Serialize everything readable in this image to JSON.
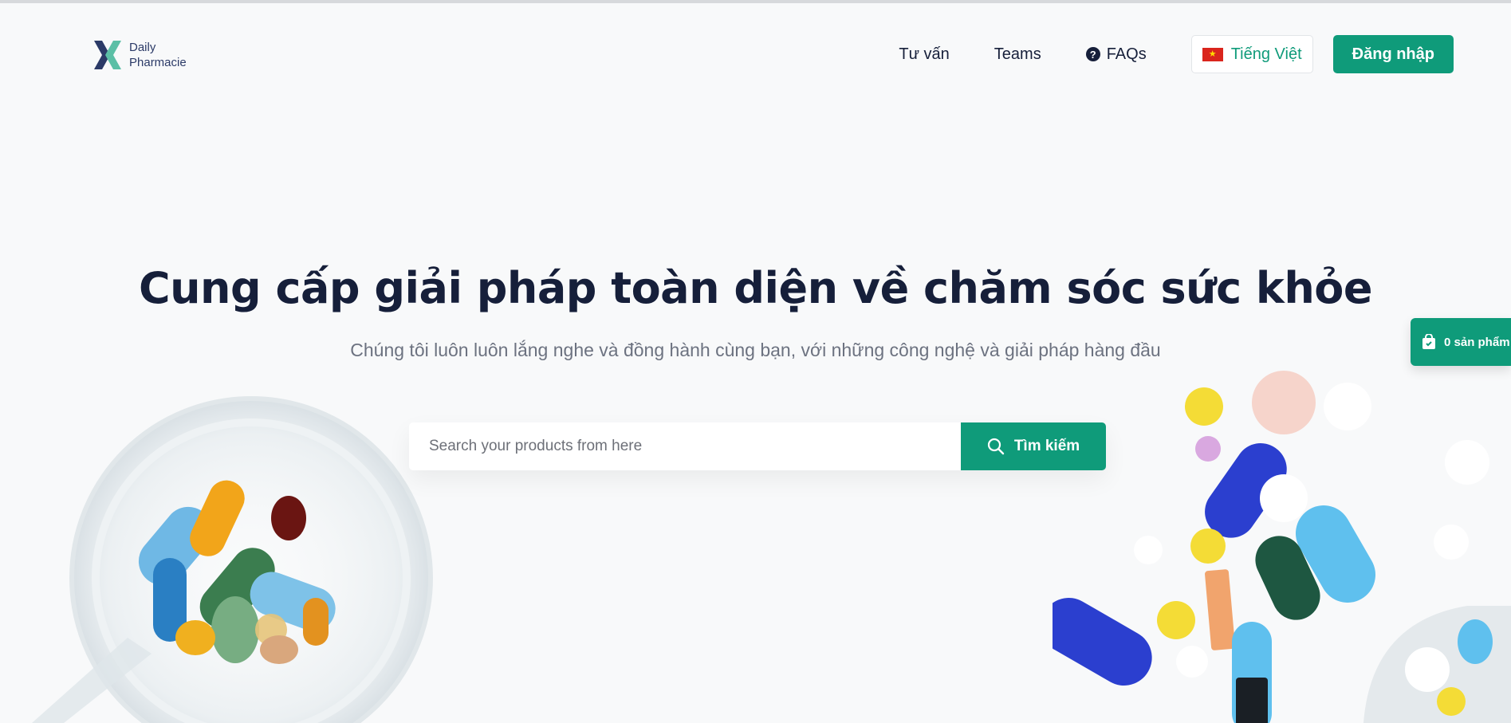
{
  "brand": {
    "line1": "Daily",
    "line2": "Pharmacie",
    "logo_icon": "x-logo-icon",
    "colors": {
      "dark": "#2b3a67",
      "accent": "#5bbfa6"
    }
  },
  "nav": {
    "items": [
      {
        "label": "Tư vấn"
      },
      {
        "label": "Teams"
      },
      {
        "label": "FAQs",
        "icon": "question-circle-icon"
      }
    ],
    "language": {
      "label": "Tiếng Việt",
      "icon": "vietnam-flag-icon"
    },
    "login_label": "Đăng nhập"
  },
  "hero": {
    "title": "Cung cấp giải pháp toàn diện về chăm sóc sức khỏe",
    "subtitle": "Chúng tôi luôn luôn lắng nghe và đồng hành cùng bạn, với những công nghệ và giải pháp hàng đầu"
  },
  "search": {
    "placeholder": "Search your products from here",
    "value": "",
    "button_label": "Tìm kiếm",
    "button_icon": "search-icon"
  },
  "cart": {
    "label": "0 sản phẩm",
    "icon": "shopping-bag-icon"
  },
  "colors": {
    "primary": "#0f9b7a",
    "heading": "#161f3a",
    "muted": "#6c7280",
    "background": "#f8f9fa"
  }
}
